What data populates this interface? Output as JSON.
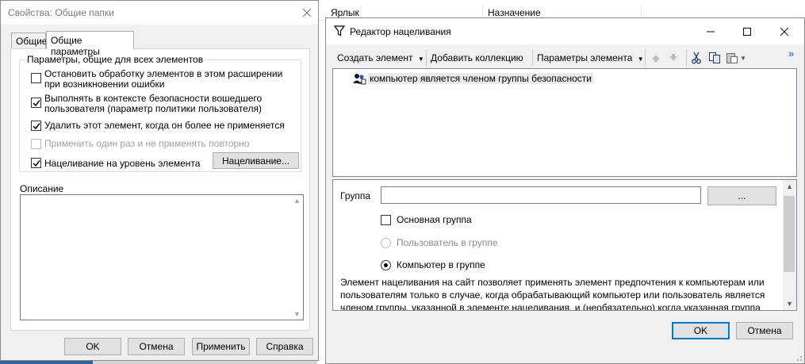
{
  "background": {
    "columns": [
      "Ярлык",
      "Назначение"
    ]
  },
  "properties_dialog": {
    "title": "Свойства: Общие папки",
    "tabs": [
      "Общие",
      "Общие параметры"
    ],
    "active_tab": 1,
    "group_title": "Параметры, общие для всех элементов",
    "options": [
      {
        "label": "Остановить обработку элементов в этом расширении при возникновении ошибки",
        "checked": false,
        "enabled": true
      },
      {
        "label": "Выполнять в контексте безопасности вошедшего пользователя (параметр политики пользователя)",
        "checked": true,
        "enabled": true
      },
      {
        "label": "Удалить этот элемент, когда он более не применяется",
        "checked": true,
        "enabled": true
      },
      {
        "label": "Применить один раз и не применять повторно",
        "checked": false,
        "enabled": false
      },
      {
        "label": "Нацеливание на уровень элемента",
        "checked": true,
        "enabled": true
      }
    ],
    "targeting_button": "Нацеливание...",
    "description_label": "Описание",
    "description_value": "",
    "buttons": {
      "ok": "OK",
      "cancel": "Отмена",
      "apply": "Применить",
      "help": "Справка"
    }
  },
  "targeting_editor": {
    "title": "Редактор нацеливания",
    "toolbar": {
      "new_item": "Создать элемент",
      "add_collection": "Добавить коллекцию",
      "item_options": "Параметры элемента",
      "overflow": "»"
    },
    "tree_items": [
      {
        "label": "компьютер является членом группы безопасности",
        "icon": "security-group-icon"
      }
    ],
    "props": {
      "group_label": "Группа",
      "group_value": "",
      "browse_button": "...",
      "primary_group_label": "Основная группа",
      "primary_group_checked": false,
      "user_in_group_label": "Пользователь в группе",
      "user_in_group_selected": false,
      "computer_in_group_label": "Компьютер в группе",
      "computer_in_group_selected": true,
      "description": "Элемент нацеливания на сайт позволяет применять элемент предпочтения к компьютерам или пользователям только в случае, когда обрабатывающий компьютер или пользователь является членом группы, указанной в элементе нацеливания, и (необязательно) когда указанная группа"
    },
    "buttons": {
      "ok": "OK",
      "cancel": "Отмена"
    }
  }
}
